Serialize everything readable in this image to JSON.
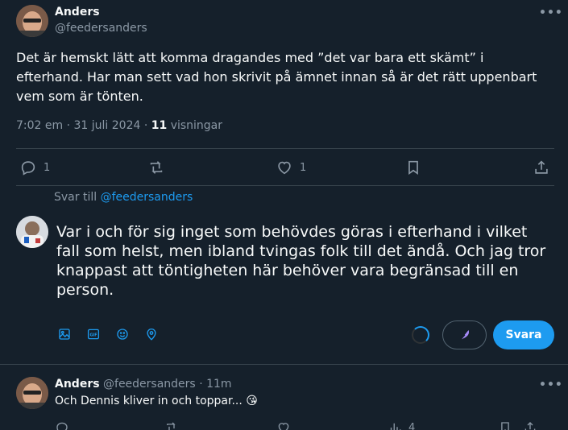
{
  "main_tweet": {
    "author_name": "Anders",
    "author_handle": "@feedersanders",
    "text": "Det är hemskt lätt att komma dragandes med ”det var bara ett skämt” i efterhand. Har man sett vad hon skrivit på ämnet innan så är det rätt uppenbart vem som är tönten.",
    "time": "7:02 em",
    "date": "31 juli 2024",
    "views_count": "11",
    "views_label": "visningar",
    "more_label": "•••",
    "actions": {
      "reply_count": "1",
      "like_count": "1"
    }
  },
  "composer": {
    "reply_to_prefix": "Svar till",
    "reply_to_handle": "@feedersanders",
    "text": "Var i och för sig inget som behövdes göras i efterhand i vilket fall som helst, men ibland tvingas folk till det ändå. Och jag tror knappast att töntigheten här behöver vara begränsad till en person.",
    "reply_button": "Svara",
    "tools": [
      "image-icon",
      "gif-icon",
      "emoji-icon",
      "location-icon"
    ]
  },
  "reply_tweet": {
    "author_name": "Anders",
    "author_handle": "@feedersanders",
    "time": "11m",
    "text": "Och Dennis kliver in och toppar...",
    "emoji": "😘",
    "more_label": "•••",
    "views_count": "4"
  },
  "colors": {
    "background": "#15202b",
    "accent": "#1d9bf0",
    "muted": "#8b98a5",
    "divider": "#38444d"
  }
}
